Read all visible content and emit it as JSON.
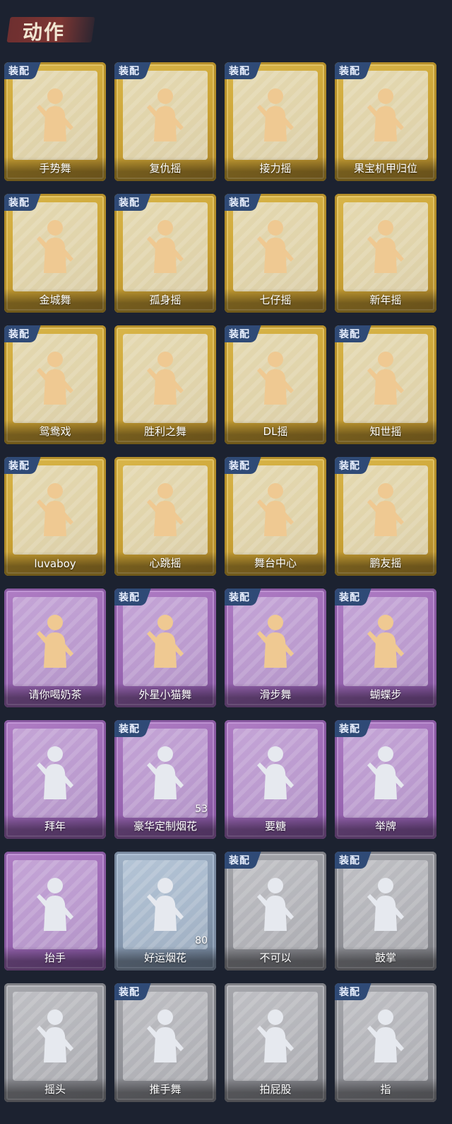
{
  "header": {
    "title": "动作"
  },
  "badge_text": "装配",
  "cards": [
    {
      "label": "手势舞",
      "tier": "gold",
      "equipped": true,
      "count": null
    },
    {
      "label": "复仇摇",
      "tier": "gold",
      "equipped": true,
      "count": null
    },
    {
      "label": "接力摇",
      "tier": "gold",
      "equipped": true,
      "count": null
    },
    {
      "label": "果宝机甲归位",
      "tier": "gold",
      "equipped": true,
      "count": null
    },
    {
      "label": "金城舞",
      "tier": "gold",
      "equipped": true,
      "count": null
    },
    {
      "label": "孤身摇",
      "tier": "gold",
      "equipped": true,
      "count": null
    },
    {
      "label": "七仔摇",
      "tier": "gold",
      "equipped": true,
      "count": null
    },
    {
      "label": "新年摇",
      "tier": "gold",
      "equipped": false,
      "count": null
    },
    {
      "label": "鸳鸯戏",
      "tier": "gold",
      "equipped": true,
      "count": null
    },
    {
      "label": "胜利之舞",
      "tier": "gold",
      "equipped": false,
      "count": null
    },
    {
      "label": "DL摇",
      "tier": "gold",
      "equipped": true,
      "count": null
    },
    {
      "label": "知世摇",
      "tier": "gold",
      "equipped": true,
      "count": null
    },
    {
      "label": "luvaboy",
      "tier": "gold",
      "equipped": true,
      "count": null
    },
    {
      "label": "心跳摇",
      "tier": "gold",
      "equipped": false,
      "count": null
    },
    {
      "label": "舞台中心",
      "tier": "gold",
      "equipped": true,
      "count": null
    },
    {
      "label": "鹏友摇",
      "tier": "gold",
      "equipped": true,
      "count": null
    },
    {
      "label": "请你喝奶茶",
      "tier": "purple",
      "equipped": false,
      "count": null
    },
    {
      "label": "外星小猫舞",
      "tier": "purple",
      "equipped": true,
      "count": null
    },
    {
      "label": "滑步舞",
      "tier": "purple",
      "equipped": true,
      "count": null
    },
    {
      "label": "蝴蝶步",
      "tier": "purple",
      "equipped": true,
      "count": null
    },
    {
      "label": "拜年",
      "tier": "purple",
      "equipped": false,
      "count": null
    },
    {
      "label": "豪华定制烟花",
      "tier": "purple",
      "equipped": true,
      "count": "53"
    },
    {
      "label": "要糖",
      "tier": "purple",
      "equipped": false,
      "count": null
    },
    {
      "label": "举牌",
      "tier": "purple",
      "equipped": true,
      "count": null
    },
    {
      "label": "抬手",
      "tier": "purple",
      "equipped": false,
      "count": null
    },
    {
      "label": "好运烟花",
      "tier": "blue",
      "equipped": false,
      "count": "80"
    },
    {
      "label": "不可以",
      "tier": "gray",
      "equipped": true,
      "count": null
    },
    {
      "label": "鼓掌",
      "tier": "gray",
      "equipped": true,
      "count": null
    },
    {
      "label": "摇头",
      "tier": "gray",
      "equipped": false,
      "count": null
    },
    {
      "label": "推手舞",
      "tier": "gray",
      "equipped": true,
      "count": null
    },
    {
      "label": "拍屁股",
      "tier": "gray",
      "equipped": false,
      "count": null
    },
    {
      "label": "指",
      "tier": "gray",
      "equipped": true,
      "count": null
    }
  ]
}
